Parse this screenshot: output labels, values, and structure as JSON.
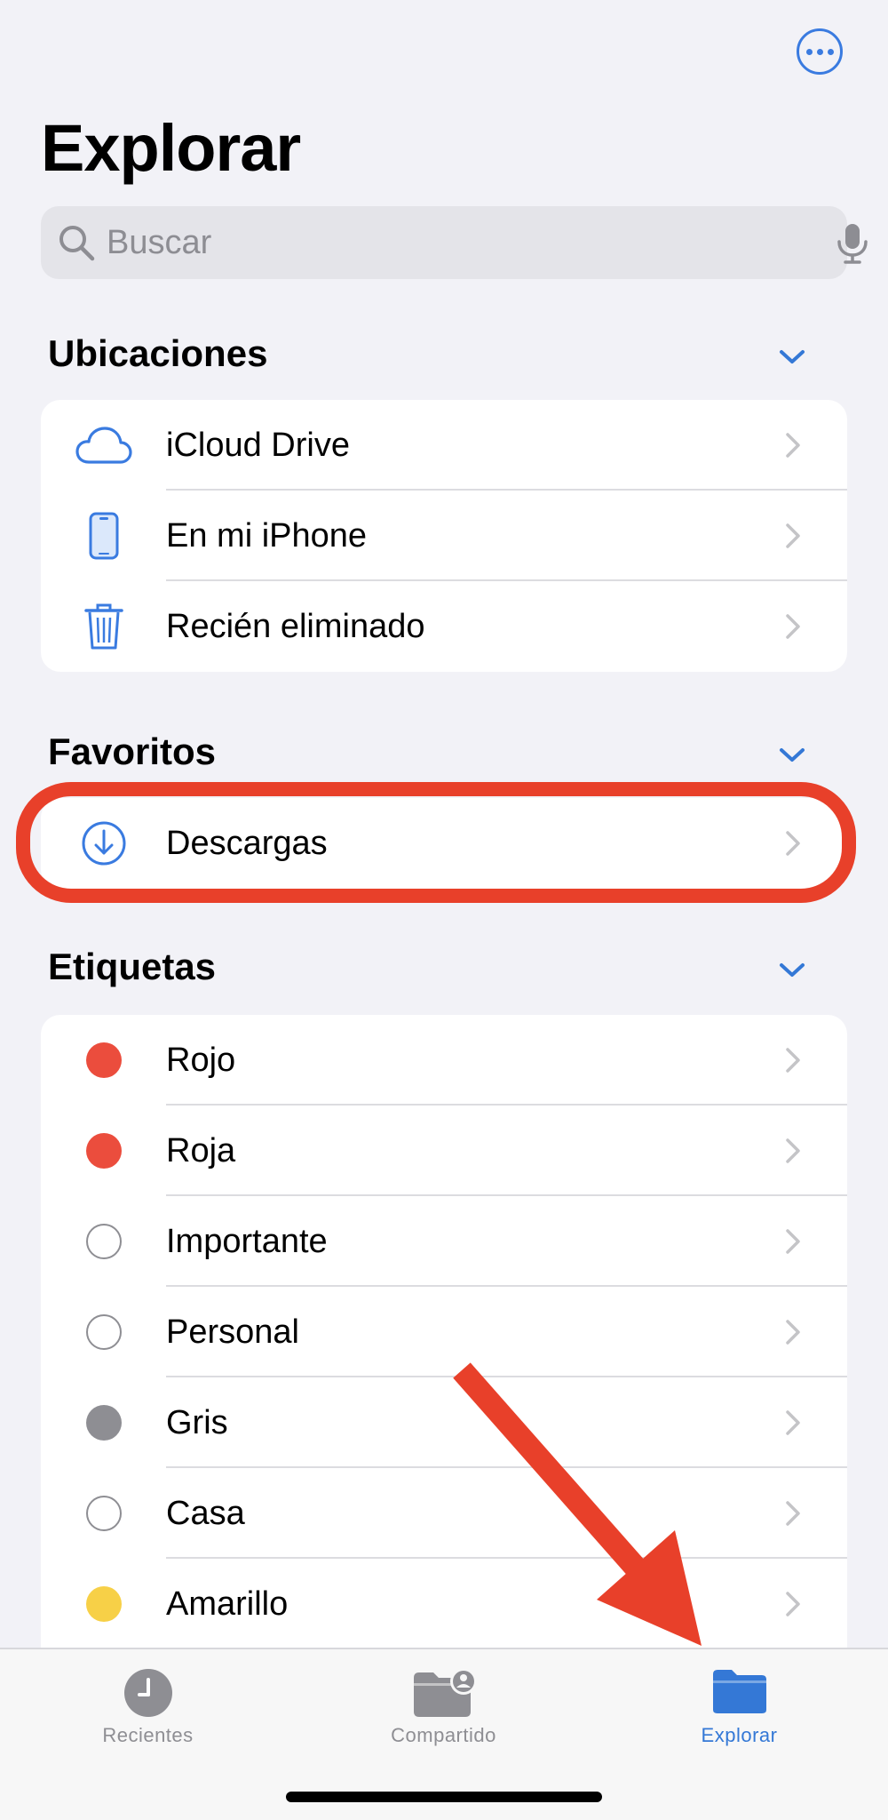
{
  "header": {
    "more_button_icon": "ellipsis-circle-icon",
    "title": "Explorar"
  },
  "search": {
    "placeholder": "Buscar",
    "icon": "magnifier-icon",
    "mic_icon": "microphone-icon"
  },
  "sections": {
    "locations": {
      "title": "Ubicaciones",
      "items": [
        {
          "label": "iCloud Drive",
          "icon": "cloud-icon"
        },
        {
          "label": "En mi iPhone",
          "icon": "iphone-icon"
        },
        {
          "label": "Recién eliminado",
          "icon": "trash-icon"
        }
      ]
    },
    "favorites": {
      "title": "Favoritos",
      "items": [
        {
          "label": "Descargas",
          "icon": "download-circle-icon"
        }
      ]
    },
    "tags": {
      "title": "Etiquetas",
      "items": [
        {
          "label": "Rojo",
          "color": "#eb4d3d",
          "style": "filled"
        },
        {
          "label": "Roja",
          "color": "#eb4d3d",
          "style": "filled"
        },
        {
          "label": "Importante",
          "color": "#ffffff",
          "style": "hollow"
        },
        {
          "label": "Personal",
          "color": "#ffffff",
          "style": "hollow"
        },
        {
          "label": "Gris",
          "color": "#8e8e93",
          "style": "filled"
        },
        {
          "label": "Casa",
          "color": "#ffffff",
          "style": "hollow"
        },
        {
          "label": "Amarillo",
          "color": "#f7d047",
          "style": "filled"
        }
      ]
    }
  },
  "tabbar": {
    "tabs": [
      {
        "label": "Recientes",
        "icon": "clock-icon",
        "active": false
      },
      {
        "label": "Compartido",
        "icon": "shared-folder-icon",
        "active": false
      },
      {
        "label": "Explorar",
        "icon": "folder-icon",
        "active": true
      }
    ]
  },
  "colors": {
    "accent": "#3478d6",
    "annotation": "#e8402a",
    "background": "#f2f2f7"
  }
}
